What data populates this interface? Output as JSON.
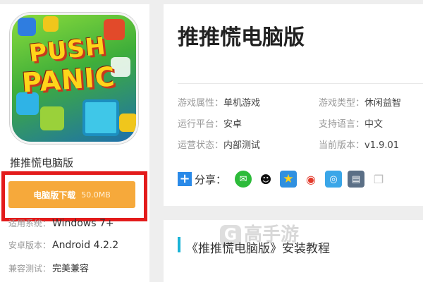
{
  "game": {
    "icon_logo_line1": "PUSH",
    "icon_logo_line2": "PANIC",
    "name": "推推慌电脑版"
  },
  "download": {
    "label": "电脑版下载",
    "size": "50.0MB"
  },
  "specs": [
    {
      "key": "适用系统：",
      "value": "Windows 7+"
    },
    {
      "key": "安卓版本：",
      "value": "Android 4.2.2"
    },
    {
      "key": "兼容测试：",
      "value": "完美兼容"
    }
  ],
  "detail": {
    "title": "推推慌电脑版",
    "attributes": [
      {
        "key": "游戏属性：",
        "value": "单机游戏"
      },
      {
        "key": "游戏类型：",
        "value": "休闲益智"
      },
      {
        "key": "运行平台：",
        "value": "安卓"
      },
      {
        "key": "支持语言：",
        "value": "中文"
      },
      {
        "key": "运营状态：",
        "value": "内部测试"
      },
      {
        "key": "当前版本：",
        "value": "v1.9.01"
      }
    ],
    "share_label": "分享：",
    "share_icons": [
      "wechat-icon",
      "qq-icon",
      "qzone-icon",
      "weibo-icon",
      "tencent-weibo-icon",
      "print-icon",
      "copy-icon"
    ]
  },
  "tutorial": {
    "title": "《推推慌电脑版》安装教程",
    "watermark": "高手游"
  },
  "colors": {
    "download_button": "#f6a93b",
    "highlight_border": "#e31b1b",
    "accent_bar": "#1ab3d6"
  }
}
